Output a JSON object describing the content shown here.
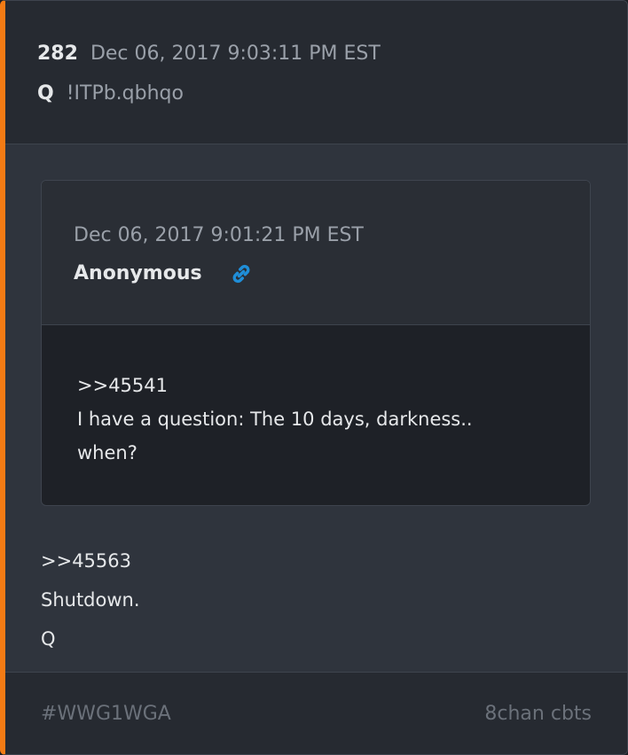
{
  "post": {
    "number": "282",
    "date": "Dec 06, 2017 9:03:11 PM EST",
    "author": "Q",
    "tripcode": "!ITPb.qbhqo",
    "body_lines": [
      ">>45563",
      "Shutdown.",
      "Q"
    ]
  },
  "quoted_post": {
    "date": "Dec 06, 2017 9:01:21 PM EST",
    "author": "Anonymous",
    "link_icon": "link-icon",
    "body_lines": [
      ">>45541",
      "I have a question: The 10 days, darkness..",
      "when?"
    ]
  },
  "footer": {
    "tag": "#WWG1WGA",
    "source": "8chan cbts"
  },
  "colors": {
    "accent": "#f47b14",
    "link": "#1f8ed8"
  }
}
